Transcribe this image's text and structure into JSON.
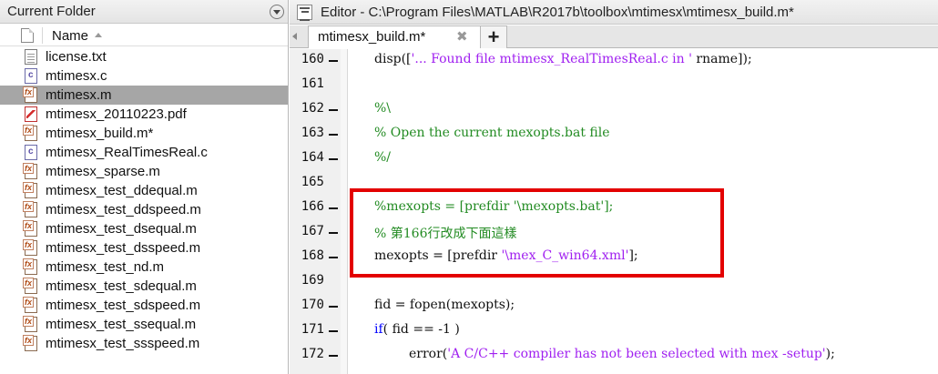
{
  "folder_panel": {
    "title": "Current Folder",
    "column_name": "Name",
    "files": [
      {
        "name": "license.txt",
        "type": "txt",
        "selected": false
      },
      {
        "name": "mtimesx.c",
        "type": "c",
        "selected": false
      },
      {
        "name": "mtimesx.m",
        "type": "m",
        "selected": true
      },
      {
        "name": "mtimesx_20110223.pdf",
        "type": "pdf",
        "selected": false
      },
      {
        "name": "mtimesx_build.m*",
        "type": "m",
        "selected": false
      },
      {
        "name": "mtimesx_RealTimesReal.c",
        "type": "c",
        "selected": false
      },
      {
        "name": "mtimesx_sparse.m",
        "type": "m",
        "selected": false
      },
      {
        "name": "mtimesx_test_ddequal.m",
        "type": "m",
        "selected": false
      },
      {
        "name": "mtimesx_test_ddspeed.m",
        "type": "m",
        "selected": false
      },
      {
        "name": "mtimesx_test_dsequal.m",
        "type": "m",
        "selected": false
      },
      {
        "name": "mtimesx_test_dsspeed.m",
        "type": "m",
        "selected": false
      },
      {
        "name": "mtimesx_test_nd.m",
        "type": "m",
        "selected": false
      },
      {
        "name": "mtimesx_test_sdequal.m",
        "type": "m",
        "selected": false
      },
      {
        "name": "mtimesx_test_sdspeed.m",
        "type": "m",
        "selected": false
      },
      {
        "name": "mtimesx_test_ssequal.m",
        "type": "m",
        "selected": false
      },
      {
        "name": "mtimesx_test_ssspeed.m",
        "type": "m",
        "selected": false
      }
    ]
  },
  "editor": {
    "title": "Editor - C:\\Program Files\\MATLAB\\R2017b\\toolbox\\mtimesx\\mtimesx_build.m*",
    "tab_label": "mtimesx_build.m*",
    "tab_close": "✖",
    "add_tab": "+",
    "colors": {
      "string": "#a020f0",
      "comment": "#228b22",
      "keyword": "#0000ff",
      "highlight_box": "#e30000"
    },
    "lines": [
      {
        "num": "160",
        "dash": true,
        "indent": false,
        "tokens": [
          {
            "t": "plain",
            "v": "disp(["
          },
          {
            "t": "str",
            "v": "'... Found file mtimesx_RealTimesReal.c in '"
          },
          {
            "t": "plain",
            "v": " rname]);"
          }
        ]
      },
      {
        "num": "161",
        "dash": false,
        "indent": false,
        "tokens": []
      },
      {
        "num": "162",
        "dash": true,
        "indent": false,
        "tokens": [
          {
            "t": "comment",
            "v": "%\\"
          }
        ]
      },
      {
        "num": "163",
        "dash": true,
        "indent": false,
        "tokens": [
          {
            "t": "comment",
            "v": "% Open the current mexopts.bat file"
          }
        ]
      },
      {
        "num": "164",
        "dash": true,
        "indent": false,
        "tokens": [
          {
            "t": "comment",
            "v": "%/"
          }
        ]
      },
      {
        "num": "165",
        "dash": false,
        "indent": false,
        "tokens": []
      },
      {
        "num": "166",
        "dash": true,
        "indent": false,
        "tokens": [
          {
            "t": "comment",
            "v": "%mexopts = [prefdir '\\mexopts.bat'];"
          }
        ]
      },
      {
        "num": "167",
        "dash": true,
        "indent": false,
        "tokens": [
          {
            "t": "comment",
            "v": "% 第166行改成下面這樣"
          }
        ]
      },
      {
        "num": "168",
        "dash": true,
        "indent": false,
        "tokens": [
          {
            "t": "plain",
            "v": "mexopts = [prefdir "
          },
          {
            "t": "str",
            "v": "'\\mex_C_win64.xml'"
          },
          {
            "t": "plain",
            "v": "];"
          }
        ]
      },
      {
        "num": "169",
        "dash": false,
        "indent": false,
        "tokens": []
      },
      {
        "num": "170",
        "dash": true,
        "indent": false,
        "tokens": [
          {
            "t": "plain",
            "v": "fid = fopen(mexopts);"
          }
        ]
      },
      {
        "num": "171",
        "dash": true,
        "indent": false,
        "tokens": [
          {
            "t": "kw",
            "v": "if"
          },
          {
            "t": "plain",
            "v": "( fid == -1 )"
          }
        ]
      },
      {
        "num": "172",
        "dash": true,
        "indent": true,
        "tokens": [
          {
            "t": "plain",
            "v": "error("
          },
          {
            "t": "str",
            "v": "'A C/C++ compiler has not been selected with mex -setup'"
          },
          {
            "t": "plain",
            "v": ");"
          }
        ]
      }
    ]
  }
}
